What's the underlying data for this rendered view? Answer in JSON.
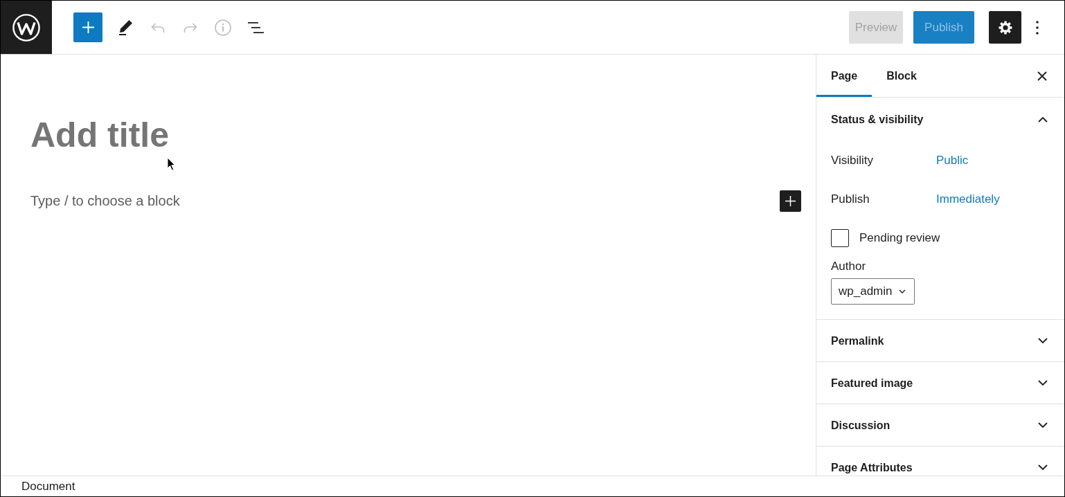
{
  "header": {
    "tools": [
      {
        "kind": "add",
        "disabled": false
      },
      {
        "kind": "edit",
        "disabled": false
      },
      {
        "kind": "undo",
        "disabled": true
      },
      {
        "kind": "redo",
        "disabled": true
      },
      {
        "kind": "details",
        "disabled": true
      },
      {
        "kind": "outline",
        "disabled": false
      }
    ],
    "preview": {
      "label": "Preview",
      "disabled": true
    },
    "publish": {
      "label": "Publish",
      "disabled": true
    },
    "settings": {
      "pressed": true
    }
  },
  "editor": {
    "title": {
      "placeholder": "Add title"
    },
    "block": {
      "placeholder": "Type / to choose a block"
    }
  },
  "sidebar": {
    "tabs": [
      {
        "label": "Page",
        "selected": true
      },
      {
        "label": "Block",
        "selected": false
      }
    ],
    "panels": [
      {
        "title": "Status & visibility",
        "expanded": true,
        "fields": [
          {
            "kind": "link",
            "label": "Visibility",
            "value": "Public"
          },
          {
            "kind": "link",
            "label": "Publish",
            "value": "Immediately"
          },
          {
            "kind": "checkbox",
            "label": "Pending review",
            "checked": false
          },
          {
            "kind": "select",
            "label": "Author",
            "value": "wp_admin"
          }
        ]
      },
      {
        "title": "Permalink",
        "expanded": false
      },
      {
        "title": "Featured image",
        "expanded": false
      },
      {
        "title": "Discussion",
        "expanded": false
      },
      {
        "title": "Page Attributes",
        "expanded": false
      }
    ]
  },
  "footer": {
    "breadcrumb": "Document"
  }
}
